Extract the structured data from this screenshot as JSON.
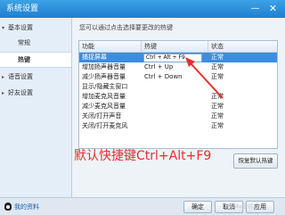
{
  "window": {
    "title": "系统设置",
    "minimize_glyph": "—",
    "close_glyph": "✕"
  },
  "sidebar": {
    "groups": [
      {
        "label": "基本设置",
        "expanded": true
      },
      {
        "label": "语音设置",
        "expanded": false
      },
      {
        "label": "好友设置",
        "expanded": false
      }
    ],
    "items": [
      {
        "label": "常规"
      },
      {
        "label": "热键",
        "selected": true
      }
    ],
    "expanded_glyph": "▾",
    "collapsed_glyph": "▸"
  },
  "hint": "您可以通过点击选择要更改的热键",
  "table": {
    "columns": [
      "功能",
      "热键",
      "状态"
    ],
    "rows": [
      {
        "function": "捕捉屏幕",
        "hotkey": "Ctrl + Alt + F9",
        "status": "正常",
        "selected": true,
        "editing": true
      },
      {
        "function": "增加扬声器音量",
        "hotkey": "Ctrl + Up",
        "status": "正常"
      },
      {
        "function": "减少扬声器音量",
        "hotkey": "Ctrl + Down",
        "status": "正常"
      },
      {
        "function": "显示/隐藏主窗口",
        "hotkey": "",
        "status": ""
      },
      {
        "function": "增加麦克风音量",
        "hotkey": "",
        "status": "正常"
      },
      {
        "function": "减少麦克风音量",
        "hotkey": "",
        "status": "正常"
      },
      {
        "function": "关闭/打开声音",
        "hotkey": "",
        "status": "正常"
      },
      {
        "function": "关闭/打开麦克风",
        "hotkey": "",
        "status": "正常"
      }
    ]
  },
  "annotation": "默认快捷键Ctrl+Alt+F9",
  "restore_button": "恢复默认热键",
  "footer": {
    "my_data": "我的资料",
    "ok": "确定",
    "cancel": "取消",
    "apply": "应用",
    "watermark": "Baidu经验"
  },
  "colors": {
    "title_bar": "#2a8ee0",
    "selection": "#3c8de0",
    "annotation": "#e62e2e"
  }
}
